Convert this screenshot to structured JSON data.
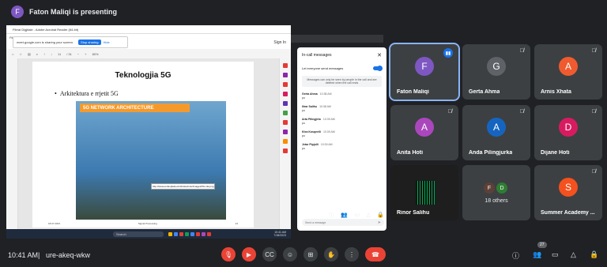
{
  "presenter": {
    "initial": "F",
    "text": "Faton Maliqi is presenting",
    "color": "#7e57c2"
  },
  "shared_screen": {
    "pdf_title": "Fibrat Digjitale - Adobe Acrobat Reader (64-bit)",
    "menu": "File  Edit  View  Sign  Window  Help",
    "share_banner": {
      "text": "meet.google.com is sharing your screen.",
      "stop": "Stop sharing",
      "hide": "Hide"
    },
    "sign_in": "Sign In",
    "toolbar": {
      "page": "11",
      "page_total": "/ 31",
      "zoom": "80%"
    },
    "slide": {
      "title": "Teknologjia 5G",
      "bullet": "Arkitektura e rrjetit 5G",
      "diagram_title": "5G NETWORK ARCHITECTURE",
      "url": "http://www.emfexplained.info/site/misc/images/5G-ntw.png",
      "footer_left": "18.07.2023",
      "footer_center": "Signal Processing",
      "footer_right": "24"
    },
    "chat": {
      "title": "In-call messages",
      "toggle_label": "Let everyone send messages",
      "note": "Messages can only be seen by people in the call and are deleted when the call ends",
      "messages": [
        {
          "name": "Gerta Ahma",
          "time": "10:38 AM",
          "text": "po"
        },
        {
          "name": "Ilirar Salihu",
          "time": "10:38 AM",
          "text": "po"
        },
        {
          "name": "Arta Pilingjirio",
          "time": "10:39 AM",
          "text": "po"
        },
        {
          "name": "Klea Kosqeelli",
          "time": "10:39 AM",
          "text": "po"
        },
        {
          "name": "Jetar Pipjolli",
          "time": "10:39 AM",
          "text": "po"
        }
      ],
      "placeholder": "Send a message"
    },
    "share_badge": "27",
    "taskbar": {
      "search": "Search",
      "time": "10:41 AM",
      "date": "7/18/2023"
    }
  },
  "tiles": [
    {
      "name": "Faton Maliqi",
      "initial": "F",
      "color": "#7e57c2",
      "speaking": true
    },
    {
      "name": "Gerta Ahma",
      "initial": "G",
      "color": "#5f6368"
    },
    {
      "name": "Arnis Xhata",
      "initial": "A",
      "color": "#ef5b2f"
    },
    {
      "name": "Anita Hoti",
      "initial": "A",
      "color": "#ab47bc"
    },
    {
      "name": "Anda Pilingjurka",
      "initial": "A",
      "color": "#1565c0"
    },
    {
      "name": "Dijane Hoti",
      "initial": "D",
      "color": "#d81b60"
    },
    {
      "name": "Rinor Salihu",
      "initial": "",
      "color": "#111111"
    },
    {
      "name": "18 others",
      "initial": "F",
      "initial2": "D",
      "color": "#5d4037",
      "color2": "#2e7d32"
    },
    {
      "name": "Summer Academy ...",
      "initial": "S",
      "color": "#f4511e"
    }
  ],
  "meeting": {
    "time": "10:41 AM",
    "separator": "|",
    "code": "ure-akeq-wkw"
  },
  "controls": {
    "participants_badge": "27"
  }
}
